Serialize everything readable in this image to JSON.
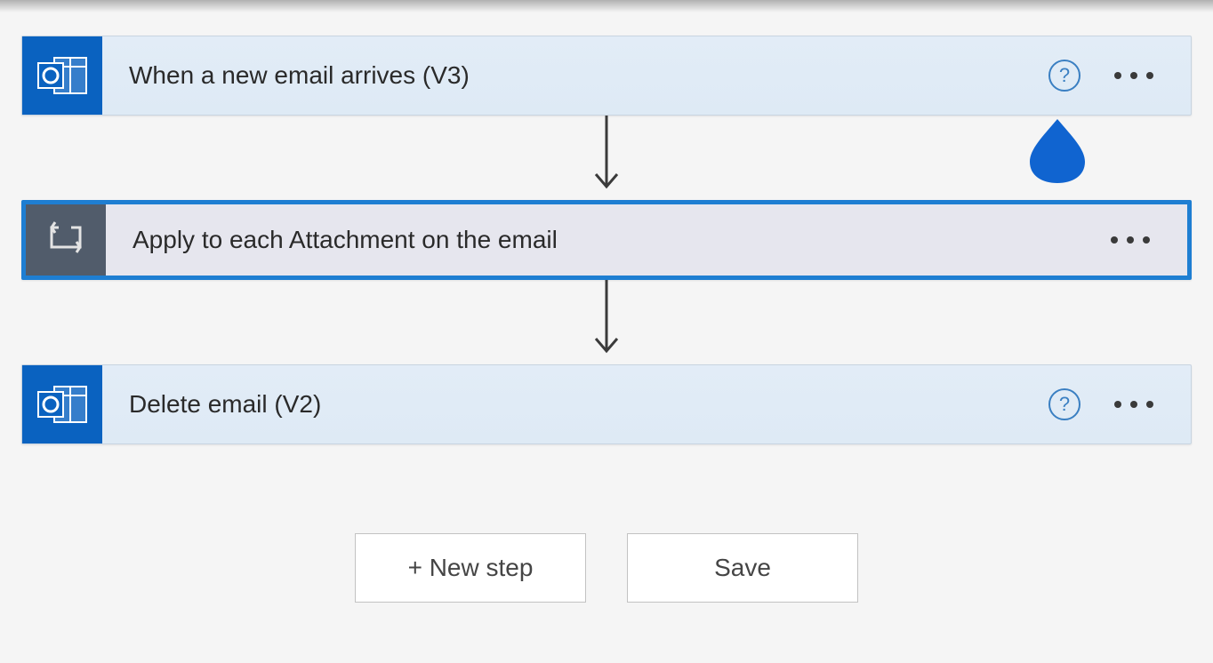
{
  "steps": [
    {
      "title": "When a new email arrives (V3)",
      "icon": "outlook",
      "has_help": true
    },
    {
      "title": "Apply to each Attachment on the email",
      "icon": "loop",
      "has_help": false,
      "selected": true
    },
    {
      "title": "Delete email (V2)",
      "icon": "outlook",
      "has_help": true
    }
  ],
  "buttons": {
    "new_step": "+ New step",
    "save": "Save"
  },
  "help_glyph": "?"
}
